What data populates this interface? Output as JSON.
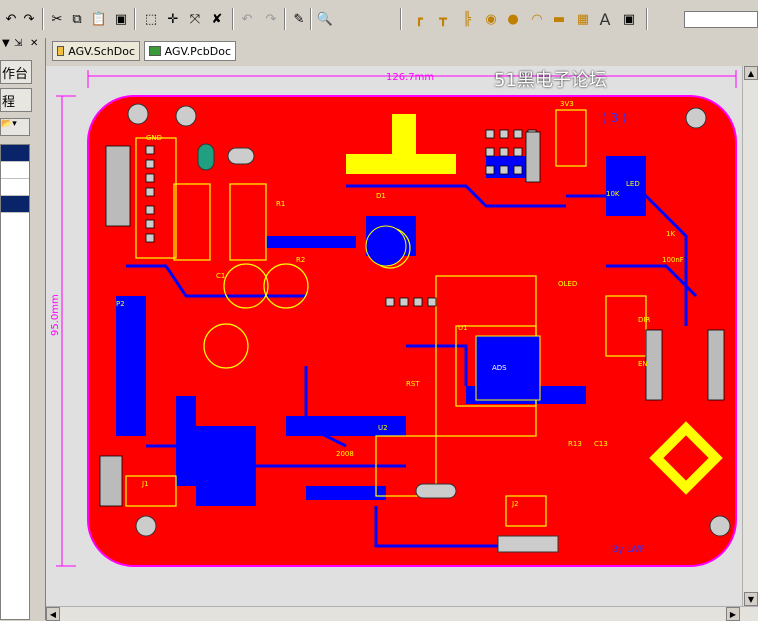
{
  "toolbar": {
    "search_value": ""
  },
  "left_panel": {
    "workbench_label": "作台",
    "project_label": "程"
  },
  "tabs": [
    {
      "label": "AGV.SchDoc"
    },
    {
      "label": "AGV.PcbDoc"
    }
  ],
  "watermark": "51黑电子论坛",
  "pcb": {
    "top_dimension": "126.7mm",
    "left_dimension": "95.0mm",
    "silk_labels": [
      "GND",
      "P2",
      "R1",
      "C1",
      "R2",
      "U1",
      "J1",
      "J2",
      "3V3",
      "D1",
      "LED",
      "OLED",
      "RST",
      "1K",
      "10K",
      "100nF",
      "(  3  )",
      "2008",
      "U2",
      "ADS",
      "R13",
      "C13",
      "DIR",
      "EN",
      "By LWF"
    ],
    "colors": {
      "board": "#ff0000",
      "copper_bottom": "#0000ff",
      "silkscreen": "#ffff00",
      "outline": "#ff00ff",
      "background": "#e0e0e0"
    }
  }
}
